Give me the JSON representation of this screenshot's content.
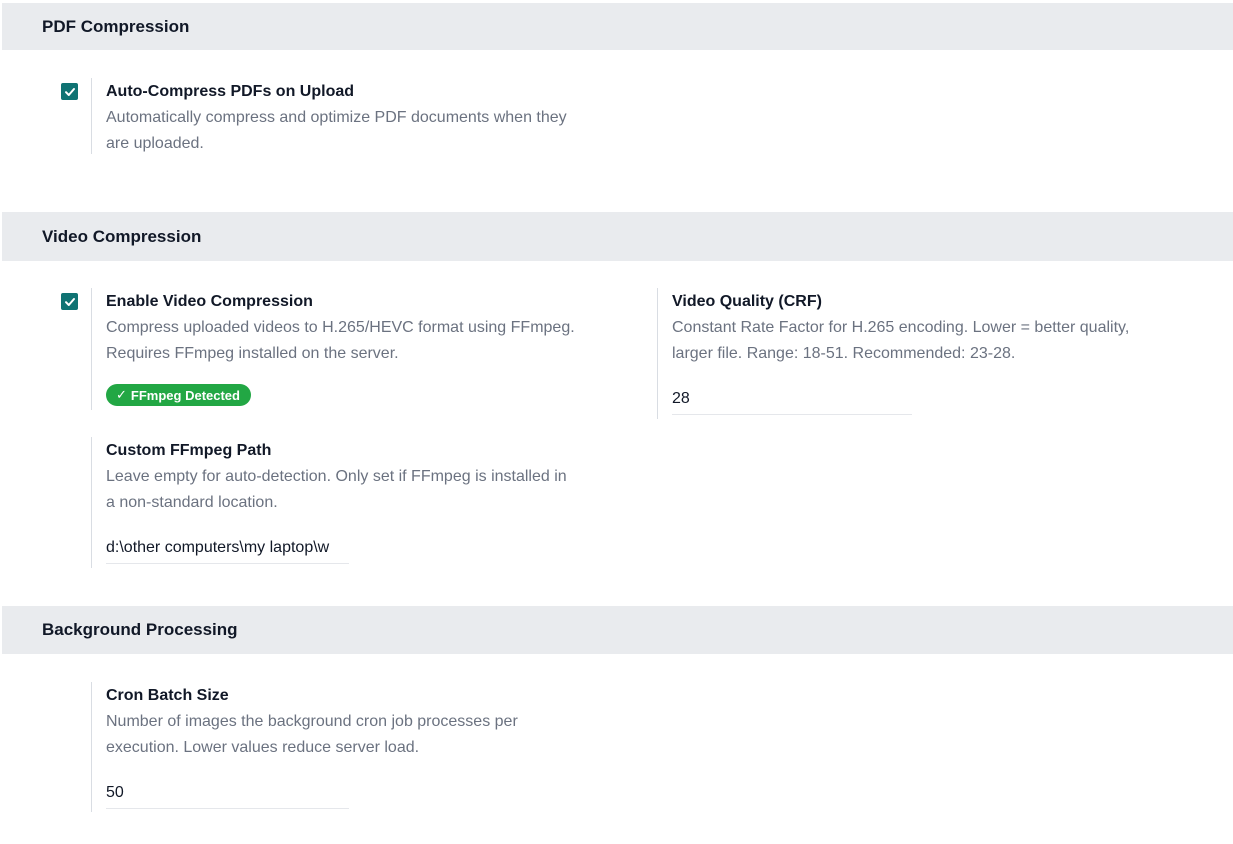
{
  "sections": {
    "pdf": {
      "title": "PDF Compression",
      "auto_compress": {
        "checked": true,
        "title": "Auto-Compress PDFs on Upload",
        "desc_line1": "Automatically compress and optimize PDF documents when they",
        "desc_line2": "are uploaded."
      }
    },
    "video": {
      "title": "Video Compression",
      "enable": {
        "checked": true,
        "title": "Enable Video Compression",
        "desc_line1": "Compress uploaded videos to H.265/HEVC format using FFmpeg.",
        "desc_line2": "Requires FFmpeg installed on the server.",
        "badge_icon": "✓",
        "badge_label": "FFmpeg Detected",
        "badge_color": "#22a744"
      },
      "quality": {
        "title": "Video Quality (CRF)",
        "desc_line1": "Constant Rate Factor for H.265 encoding. Lower = better quality,",
        "desc_line2": "larger file. Range: 18-51. Recommended: 23-28.",
        "value": "28"
      },
      "ffmpeg_path": {
        "title": "Custom FFmpeg Path",
        "desc_line1": "Leave empty for auto-detection. Only set if FFmpeg is installed in",
        "desc_line2": "a non-standard location.",
        "value": "d:\\other computers\\my laptop\\w"
      }
    },
    "background": {
      "title": "Background Processing",
      "cron_batch": {
        "title": "Cron Batch Size",
        "desc_line1": "Number of images the background cron job processes per",
        "desc_line2": "execution. Lower values reduce server load.",
        "value": "50"
      }
    }
  },
  "colors": {
    "accent": "#0f7373",
    "header_bg": "#e9ebee",
    "muted_text": "#6b7280"
  }
}
